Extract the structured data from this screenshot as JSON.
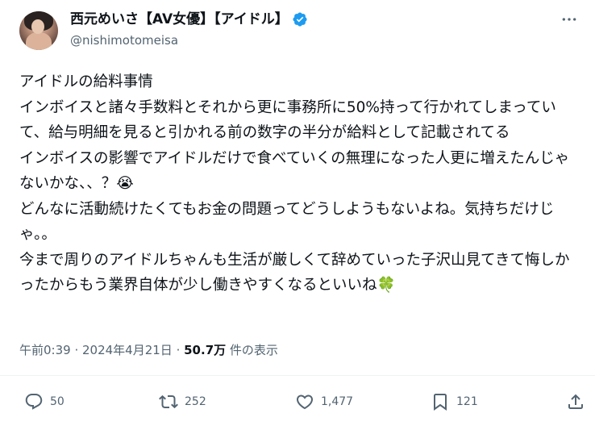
{
  "author": {
    "display_name": "西元めいさ【AV女優】【アイドル】",
    "handle": "@nishimotomeisa",
    "verified": true
  },
  "post": {
    "text": "アイドルの給料事情\nインボイスと諸々手数料とそれから更に事務所に50%持って行かれてしまっていて、給与明細を見ると引かれる前の数字の半分が給料として記載されてる\nインボイスの影響でアイドルだけで食べていくの無理になった人更に増えたんじゃないかな、、？😭\nどんなに活動続けたくてもお金の問題ってどうしようもないよね。気持ちだけじゃ。。\n今まで周りのアイドルちゃんも生活が厳しくて辞めていった子沢山見てきて悔しかったからもう業界自体が少し働きやすくなるといいね🍀",
    "time": "午前0:39",
    "separator": " · ",
    "date": "2024年4月21日",
    "views": "50.7万",
    "views_suffix": " 件の表示"
  },
  "actions": {
    "replies": "50",
    "reposts": "252",
    "likes": "1,477",
    "bookmarks": "121"
  },
  "colors": {
    "text": "#0f1419",
    "secondary": "#536471",
    "verified": "#1d9bf0"
  }
}
